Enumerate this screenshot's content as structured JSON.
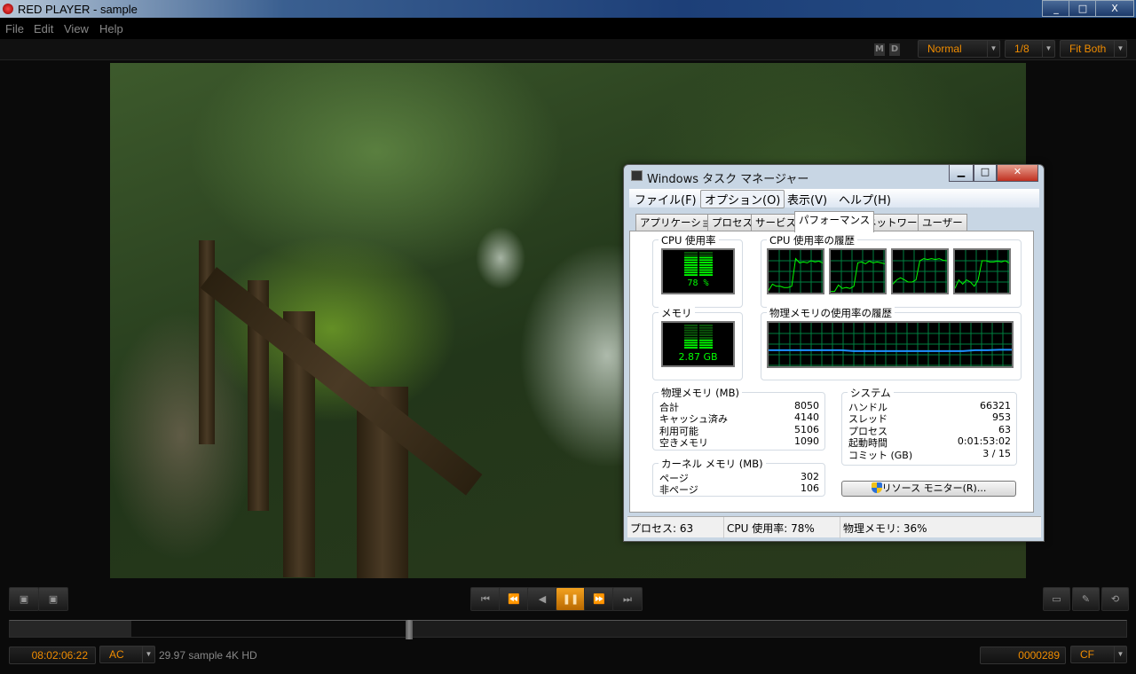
{
  "app": {
    "title": "RED PLAYER - sample",
    "window_controls": [
      "_",
      "□",
      "X"
    ]
  },
  "menu": [
    "File",
    "Edit",
    "View",
    "Help"
  ],
  "toolbar": {
    "m_label": "M",
    "d_label": "D",
    "mode": "Normal",
    "resolution": "1/8",
    "fit": "Fit Both"
  },
  "task_manager": {
    "title": "Windows タスク マネージャー",
    "menu": [
      "ファイル(F)",
      "オプション(O)",
      "表示(V)",
      "ヘルプ(H)"
    ],
    "tabs": [
      "アプリケーション",
      "プロセス",
      "サービス",
      "パフォーマンス",
      "ネットワーク",
      "ユーザー"
    ],
    "active_tab": "パフォーマンス",
    "cpu_usage": {
      "label": "CPU 使用率",
      "value": "78 %",
      "percent": 78
    },
    "cpu_history": {
      "label": "CPU 使用率の履歴",
      "cores": [
        [
          5,
          20,
          15,
          15,
          12,
          12,
          15,
          80,
          70,
          72,
          70,
          75,
          72,
          74,
          70
        ],
        [
          3,
          3,
          18,
          10,
          12,
          10,
          15,
          70,
          72,
          68,
          74,
          70,
          72,
          70,
          68
        ],
        [
          20,
          30,
          35,
          30,
          25,
          25,
          30,
          75,
          80,
          78,
          80,
          78,
          80,
          76,
          75
        ],
        [
          10,
          30,
          20,
          30,
          25,
          15,
          30,
          75,
          75,
          72,
          72,
          74,
          72,
          75,
          70
        ]
      ]
    },
    "memory": {
      "label": "メモリ",
      "value": "2.87 GB",
      "percent": 36
    },
    "memory_history": {
      "label": "物理メモリの使用率の履歴",
      "values": [
        37,
        37,
        37,
        37,
        37,
        37,
        37,
        35,
        35,
        35,
        35,
        35,
        35,
        35,
        35,
        35,
        35,
        37,
        37,
        38,
        38
      ]
    },
    "physical_memory": {
      "label": "物理メモリ (MB)",
      "rows": [
        {
          "k": "合計",
          "v": "8050"
        },
        {
          "k": "キャッシュ済み",
          "v": "4140"
        },
        {
          "k": "利用可能",
          "v": "5106"
        },
        {
          "k": "空きメモリ",
          "v": "1090"
        }
      ]
    },
    "kernel_memory": {
      "label": "カーネル メモリ (MB)",
      "rows": [
        {
          "k": "ページ",
          "v": "302"
        },
        {
          "k": "非ページ",
          "v": "106"
        }
      ]
    },
    "system": {
      "label": "システム",
      "rows": [
        {
          "k": "ハンドル",
          "v": "66321"
        },
        {
          "k": "スレッド",
          "v": "953"
        },
        {
          "k": "プロセス",
          "v": "63"
        },
        {
          "k": "起動時間",
          "v": "0:01:53:02"
        },
        {
          "k": "コミット (GB)",
          "v": "3 / 15"
        }
      ]
    },
    "resource_monitor_button": "リソース モニター(R)...",
    "status": {
      "processes": "プロセス: 63",
      "cpu": "CPU 使用率: 78%",
      "memory": "物理メモリ: 36%"
    },
    "colors": {
      "graph_line": "#00ff00",
      "grid": "#008040",
      "memory_line": "#1e90ff"
    }
  },
  "player": {
    "timecode": "08:02:06:22",
    "timecode_mode": "AC",
    "clip_info": "29.97 sample 4K HD",
    "frame": "0000289",
    "frame_mode": "CF",
    "progress_percent": 35.8,
    "accent": "#f08c00"
  }
}
